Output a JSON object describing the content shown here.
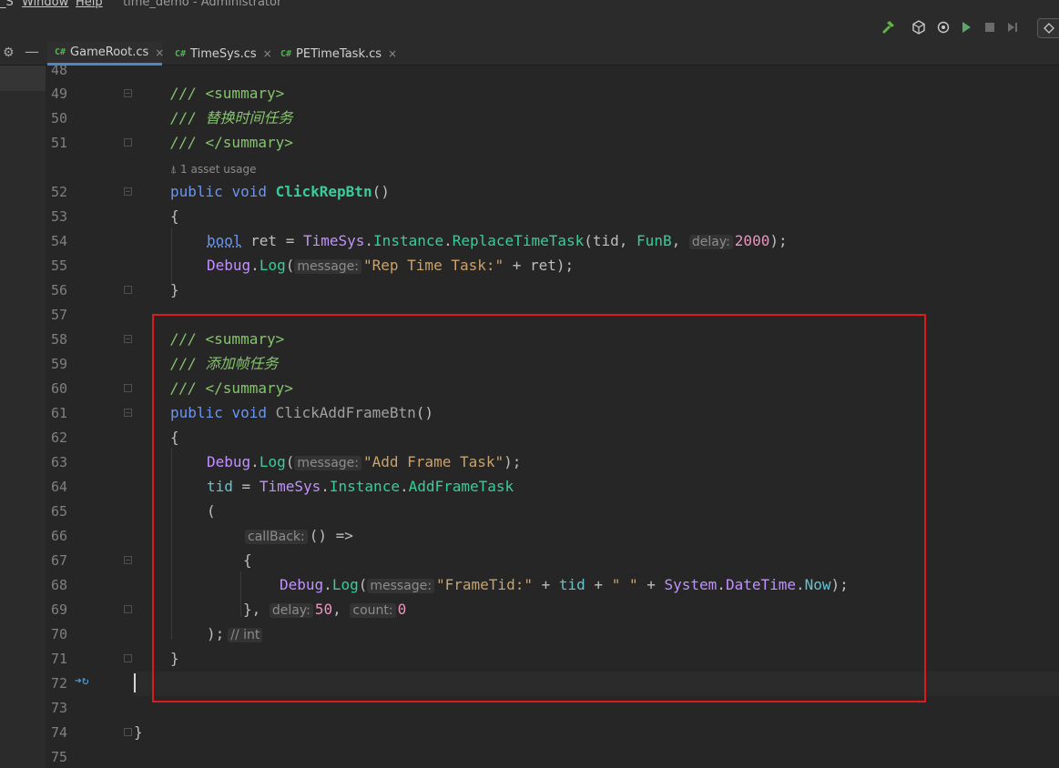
{
  "window": {
    "menu_partial": "_S",
    "menu_window": "Window",
    "menu_help": "Help",
    "title": "time_demo - Administrator"
  },
  "toolbar": {
    "build_icon": "hammer-icon",
    "unity_icon": "unity-icon",
    "attach_icon": "attach-debugger-icon",
    "play_icon": "play-icon",
    "stop_icon": "stop-icon",
    "step_icon": "step-icon"
  },
  "tabs": [
    {
      "badge": "C#",
      "label": "GameRoot.cs",
      "close": "×",
      "active": true
    },
    {
      "badge": "C#",
      "label": "TimeSys.cs",
      "close": "×",
      "active": false
    },
    {
      "badge": "C#",
      "label": "PETimeTask.cs",
      "close": "×",
      "active": false
    }
  ],
  "editor": {
    "line_numbers": [
      "48",
      "49",
      "50",
      "51",
      "52",
      "53",
      "54",
      "55",
      "56",
      "57",
      "58",
      "59",
      "60",
      "61",
      "62",
      "63",
      "64",
      "65",
      "66",
      "67",
      "68",
      "69",
      "70",
      "71",
      "72",
      "73",
      "74",
      "75"
    ],
    "usage_hint": "1 asset usage",
    "code": {
      "l49_prefix": "/// ",
      "l49_tag": "<summary>",
      "l50": "/// 替换时间任务",
      "l51_prefix": "/// ",
      "l51_tag": "</summary>",
      "l52_kw1": "public",
      "l52_kw2": "void",
      "l52_method": "ClickRepBtn",
      "l52_rest": "()",
      "l53": "{",
      "l54_type": "bool",
      "l54_a": " ret = ",
      "l54_cls": "TimeSys",
      "l54_dot1": ".",
      "l54_inst": "Instance",
      "l54_dot2": ".",
      "l54_method": "ReplaceTimeTask",
      "l54_b": "(tid, ",
      "l54_fn": "FunB",
      "l54_c": ", ",
      "l54_hint": "delay:",
      "l54_num": "2000",
      "l54_end": ");",
      "l55_cls": "Debug",
      "l55_dot": ".",
      "l55_method": "Log",
      "l55_open": "(",
      "l55_hint": "message:",
      "l55_str": "\"Rep Time Task:\"",
      "l55_end": " + ret);",
      "l56": "}",
      "l58_prefix": "/// ",
      "l58_tag": "<summary>",
      "l59": "/// 添加帧任务",
      "l60_prefix": "/// ",
      "l60_tag": "</summary>",
      "l61_kw1": "public",
      "l61_kw2": "void",
      "l61_method": "ClickAddFrameBtn",
      "l61_rest": "()",
      "l62": "{",
      "l63_cls": "Debug",
      "l63_dot": ".",
      "l63_method": "Log",
      "l63_open": "(",
      "l63_hint": "message:",
      "l63_str": "\"Add Frame Task\"",
      "l63_end": ");",
      "l64_var": "tid",
      "l64_a": " = ",
      "l64_cls": "TimeSys",
      "l64_dot1": ".",
      "l64_inst": "Instance",
      "l64_dot2": ".",
      "l64_method": "AddFrameTask",
      "l65": "(",
      "l66_hint": "callBack:",
      "l66_rest": "() =>",
      "l67": "{",
      "l68_cls": "Debug",
      "l68_dot": ".",
      "l68_method": "Log",
      "l68_open": "(",
      "l68_hint": "message:",
      "l68_str1": "\"FrameTid:\"",
      "l68_a": " + ",
      "l68_var": "tid",
      "l68_b": " + ",
      "l68_str2": "\" \"",
      "l68_c": " + ",
      "l68_cls2": "System",
      "l68_dot2": ".",
      "l68_cls3": "DateTime",
      "l68_dot3": ".",
      "l68_prop": "Now",
      "l68_end": ");",
      "l69_a": "},",
      "l69_hint1": "delay:",
      "l69_num1": "50",
      "l69_b": ",",
      "l69_hint2": "count:",
      "l69_num2": "0",
      "l70_a": ");",
      "l70_hint": "// int",
      "l71": "}",
      "l74": "}"
    }
  },
  "colors": {
    "keyword": "#6c95eb",
    "comment": "#85c46c",
    "class": "#c191ff",
    "method": "#39cc9b",
    "string": "#c9a26d",
    "number": "#ed94c0",
    "annotation_box": "#e0191c"
  }
}
